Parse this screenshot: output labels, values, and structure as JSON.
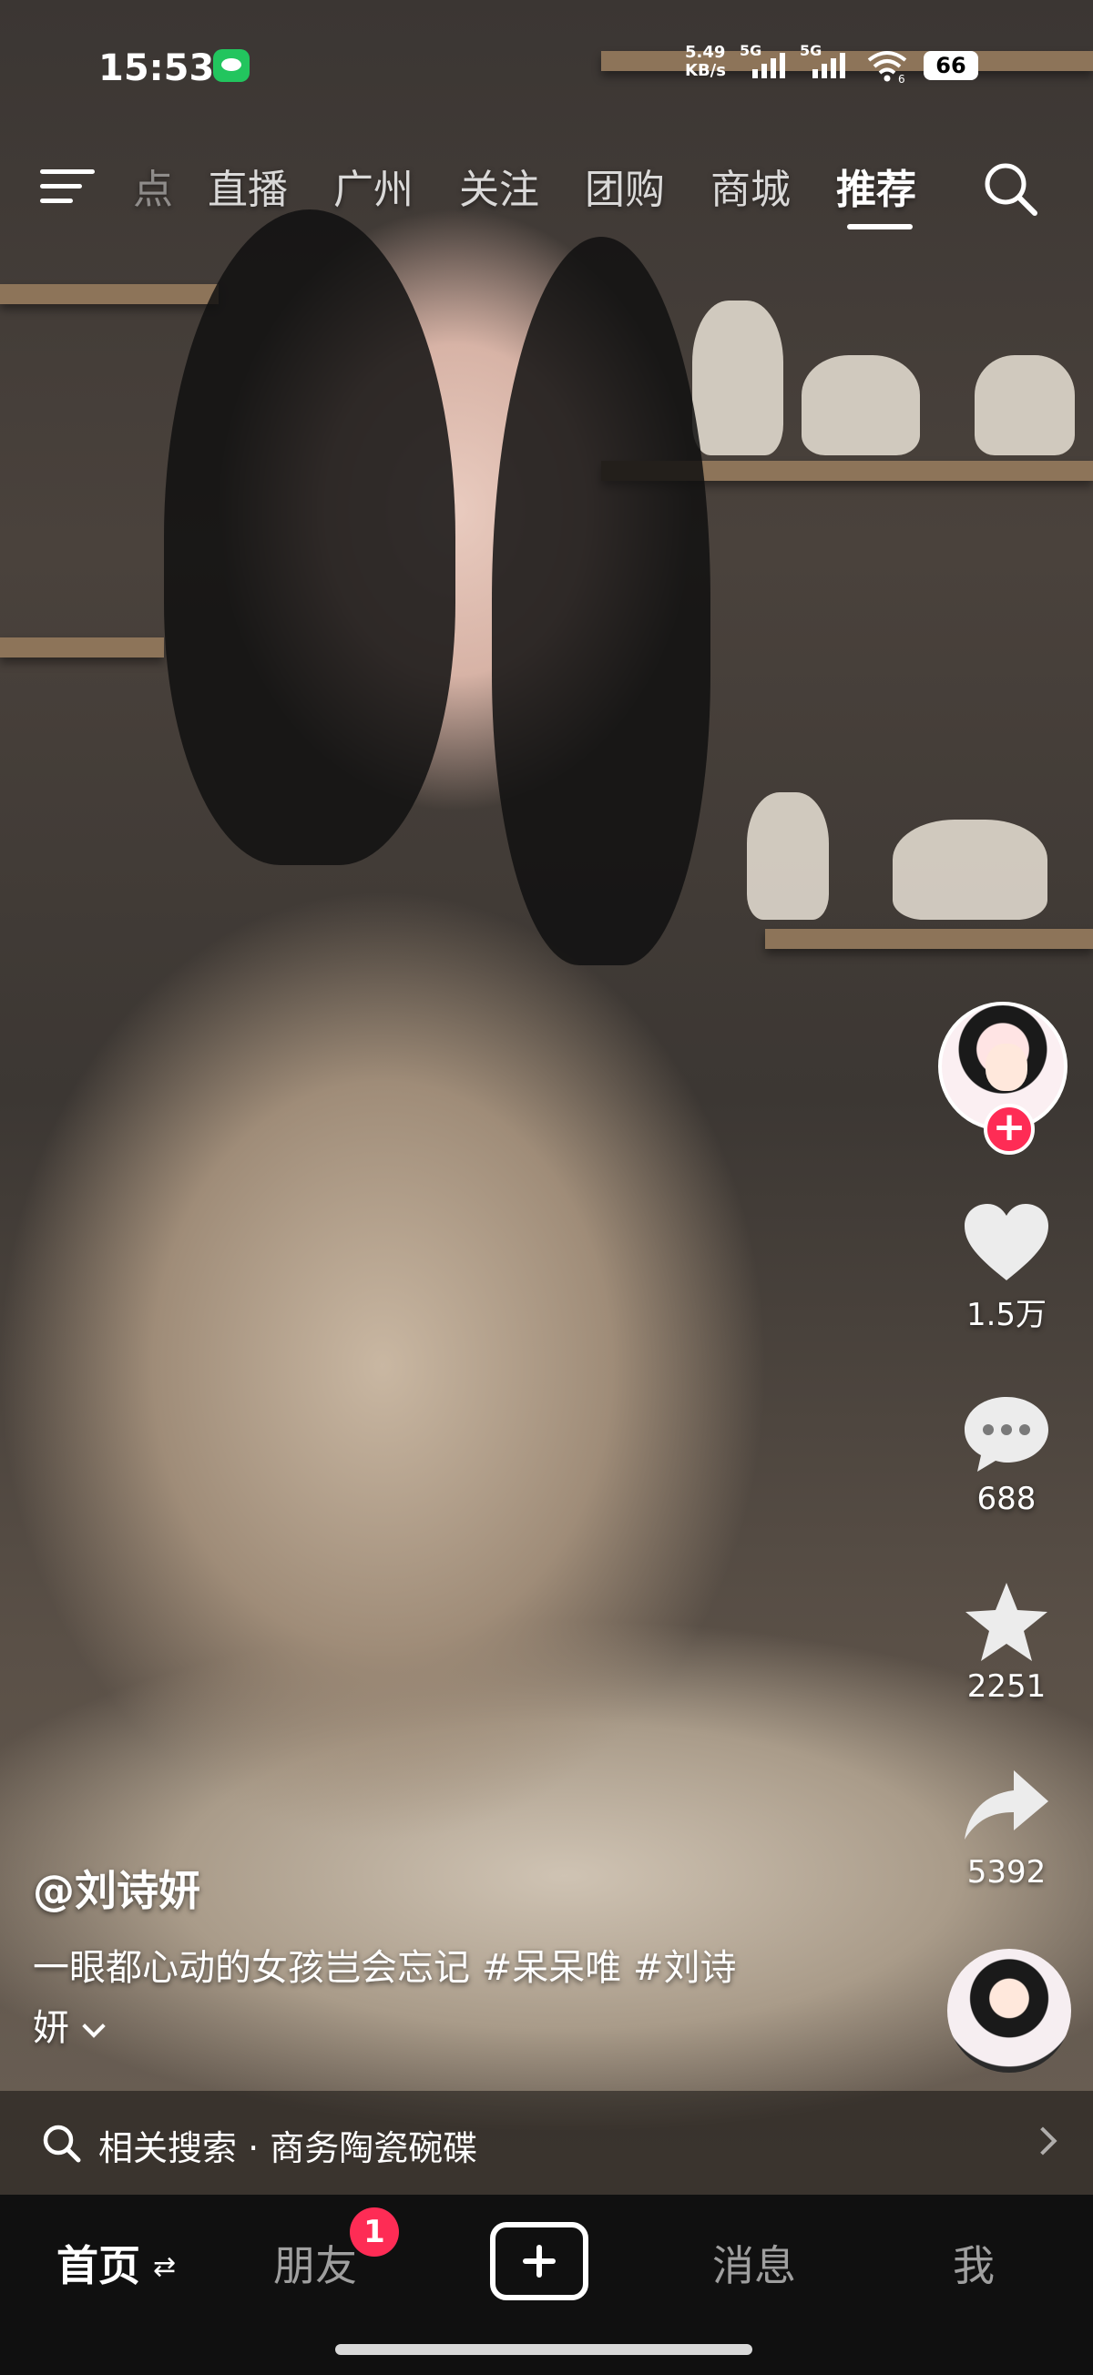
{
  "status_bar": {
    "time": "15:53",
    "net_speed_value": "5.49",
    "net_speed_unit": "KB/s",
    "net_type_1": "5G",
    "net_type_2": "5G",
    "wifi_level": "6",
    "battery": "66"
  },
  "top_nav": {
    "tabs": [
      {
        "label": "点",
        "state": "faded"
      },
      {
        "label": "直播",
        "state": "normal"
      },
      {
        "label": "广州",
        "state": "normal"
      },
      {
        "label": "关注",
        "state": "normal"
      },
      {
        "label": "团购",
        "state": "normal"
      },
      {
        "label": "商城",
        "state": "normal"
      },
      {
        "label": "推荐",
        "state": "active"
      }
    ],
    "menu_icon": "hamburger-icon",
    "search_icon": "search-icon"
  },
  "actions": {
    "likes": "1.5万",
    "comments": "688",
    "favorites": "2251",
    "shares": "5392"
  },
  "video": {
    "author": "@刘诗妍",
    "caption_line1": "一眼都心动的女孩岂会忘记 #呆呆唯 #刘诗",
    "caption_line2": "妍"
  },
  "related_search": {
    "prefix": "相关搜索",
    "separator": " · ",
    "query": "商务陶瓷碗碟"
  },
  "tab_bar": {
    "home": "首页",
    "friends": "朋友",
    "friends_badge": "1",
    "messages": "消息",
    "me": "我"
  },
  "colors": {
    "accent": "#fe2c55",
    "tab_bar_bg": "#101010",
    "wechat_green": "#22c55e"
  }
}
